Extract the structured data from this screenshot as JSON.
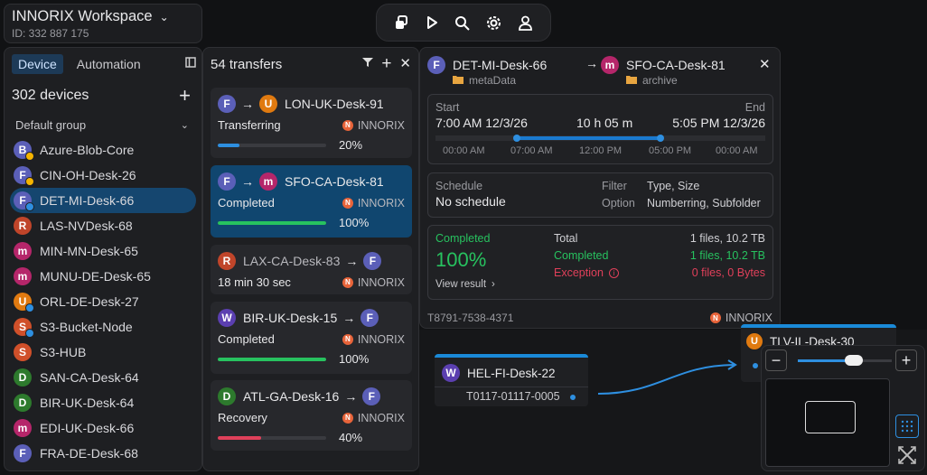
{
  "workspace": {
    "title": "INNORIX Workspace",
    "id_label": "ID: 332 887 175"
  },
  "sidebar": {
    "tabs": [
      "Device",
      "Automation"
    ],
    "device_count": "302  devices",
    "group": "Default group",
    "devices": [
      {
        "initial": "B",
        "name": "Azure-Blob-Core",
        "color": "#5b5fb8",
        "dot": "#f5b400"
      },
      {
        "initial": "F",
        "name": "CIN-OH-Desk-26",
        "color": "#5b5fb8",
        "dot": "#f5b400"
      },
      {
        "initial": "F",
        "name": "DET-MI-Desk-66",
        "color": "#5b5fb8",
        "dot": "#2e8fe0"
      },
      {
        "initial": "R",
        "name": "LAS-NVDesk-68",
        "color": "#c0452a",
        "dot": ""
      },
      {
        "initial": "m",
        "name": "MIN-MN-Desk-65",
        "color": "#b5266a",
        "dot": ""
      },
      {
        "initial": "m",
        "name": "MUNU-DE-Desk-65",
        "color": "#b5266a",
        "dot": ""
      },
      {
        "initial": "U",
        "name": "ORL-DE-Desk-27",
        "color": "#e07a10",
        "dot": "#2e8fe0"
      },
      {
        "initial": "S",
        "name": "S3-Bucket-Node",
        "color": "#d0502a",
        "dot": "#2e8fe0"
      },
      {
        "initial": "S",
        "name": "S3-HUB",
        "color": "#d0502a",
        "dot": ""
      },
      {
        "initial": "D",
        "name": "SAN-CA-Desk-64",
        "color": "#2d7a2d",
        "dot": ""
      },
      {
        "initial": "D",
        "name": "BIR-UK-Desk-64",
        "color": "#2d7a2d",
        "dot": ""
      },
      {
        "initial": "m",
        "name": "EDI-UK-Desk-66",
        "color": "#b5266a",
        "dot": ""
      },
      {
        "initial": "F",
        "name": "FRA-DE-Desk-68",
        "color": "#5b5fb8",
        "dot": ""
      }
    ]
  },
  "transfers": {
    "header": "54  transfers",
    "items": [
      {
        "src": "F",
        "src_color": "#5b5fb8",
        "dst": "U",
        "dst_color": "#e07a10",
        "name": "LON-UK-Desk-91",
        "name_side": "dst",
        "status": "Transferring",
        "brand": "INNORIX",
        "progress": 20,
        "percent": "20%",
        "bar": "#2e8fe0",
        "dim": false
      },
      {
        "src": "F",
        "src_color": "#5b5fb8",
        "dst": "m",
        "dst_color": "#b5266a",
        "name": "SFO-CA-Desk-81",
        "name_side": "dst",
        "status": "Completed",
        "brand": "INNORIX",
        "progress": 100,
        "percent": "100%",
        "bar": "#27c25f",
        "dim": false
      },
      {
        "src": "R",
        "src_color": "#c0452a",
        "dst": "F",
        "dst_color": "#5b5fb8",
        "name": "LAX-CA-Desk-83",
        "name_side": "src",
        "status": "18 min 30 sec",
        "brand": "INNORIX",
        "progress": null,
        "percent": "",
        "bar": "",
        "dim": true
      },
      {
        "src": "W",
        "src_color": "#5b3fb0",
        "dst": "F",
        "dst_color": "#5b5fb8",
        "name": "BIR-UK-Desk-15",
        "name_side": "src",
        "status": "Completed",
        "brand": "INNORIX",
        "progress": 100,
        "percent": "100%",
        "bar": "#27c25f",
        "dim": false
      },
      {
        "src": "D",
        "src_color": "#2d7a2d",
        "dst": "F",
        "dst_color": "#5b5fb8",
        "name": "ATL-GA-Desk-16",
        "name_side": "src",
        "status": "Recovery",
        "brand": "INNORIX",
        "progress": 40,
        "percent": "40%",
        "bar": "#e0405a",
        "dim": false
      }
    ]
  },
  "detail": {
    "src": {
      "initial": "F",
      "name": "DET-MI-Desk-66",
      "folder": "metaData"
    },
    "dst": {
      "initial": "m",
      "name": "SFO-CA-Desk-81",
      "folder": "archive"
    },
    "time": {
      "start_label": "Start",
      "end_label": "End",
      "start": "7:00 AM 12/3/26",
      "duration": "10 h 05 m",
      "end": "5:05 PM 12/3/26",
      "ticks": [
        "00:00 AM",
        "07:00 AM",
        "12:00 PM",
        "05:00 PM",
        "00:00 AM"
      ]
    },
    "schedule": {
      "label": "Schedule",
      "value": "No schedule",
      "filter_label": "Filter",
      "filter_value": "Type, Size",
      "option_label": "Option",
      "option_value": "Numberring, Subfolder"
    },
    "result": {
      "status": "Completed",
      "percent": "100%",
      "view": "View result",
      "total_label": "Total",
      "total_value": "1 files, 10.2 TB",
      "completed_label": "Completed",
      "completed_value": "1 files, 10.2 TB",
      "exception_label": "Exception",
      "exception_value": "0 files, 0 Bytes"
    },
    "transfer_id": "T8791-7538-4371",
    "brand": "INNORIX"
  },
  "canvas": {
    "node1": {
      "initial": "W",
      "name": "HEL-FI-Desk-22",
      "job": "T0117-01117-0005"
    },
    "node2": {
      "initial": "U",
      "name": "TLV-IL-Desk-30"
    }
  },
  "zoom": {
    "level": 0.6
  }
}
